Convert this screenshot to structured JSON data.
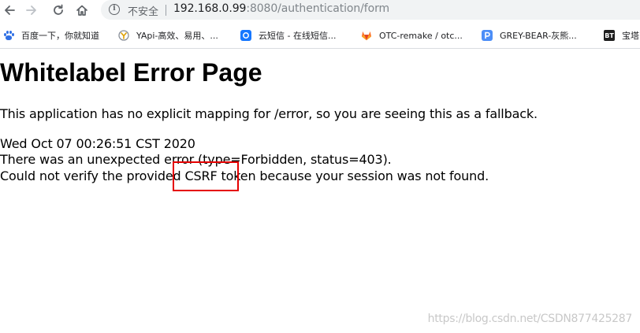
{
  "browser": {
    "address_bar": {
      "security_label": "不安全",
      "url_host": "192.168.0.99",
      "url_rest": ":8080/authentication/form"
    },
    "bookmarks": [
      {
        "label": "百度一下，你就知道",
        "icon": "baidu-paw-icon"
      },
      {
        "label": "YApi-高效、易用、...",
        "icon": "yapi-icon"
      },
      {
        "label": "云短信 - 在线短信...",
        "icon": "cloud-sms-icon"
      },
      {
        "label": "OTC-remake / otc...",
        "icon": "gitlab-icon"
      },
      {
        "label": "GREY-BEAR-灰熊...",
        "icon": "p-icon"
      },
      {
        "label": "宝塔",
        "icon": "bt-icon",
        "icon_text": "BT"
      }
    ]
  },
  "page": {
    "title": "Whitelabel Error Page",
    "fallback_text": "This application has no explicit mapping for /error, so you are seeing this as a fallback.",
    "timestamp": "Wed Oct 07 00:26:51 CST 2020",
    "error_line": "There was an unexpected error (type=Forbidden, status=403).",
    "message_line": "Could not verify the provided CSRF token because your session was not found."
  },
  "annotation": {
    "highlight_color": "#e50000"
  },
  "watermark": "https://blog.csdn.net/CSDN877425287",
  "colors": {
    "omnibox_bg": "#f1f3f4",
    "icon_gray": "#5f6368",
    "url_host": "#202124",
    "url_rest": "#80868b"
  }
}
